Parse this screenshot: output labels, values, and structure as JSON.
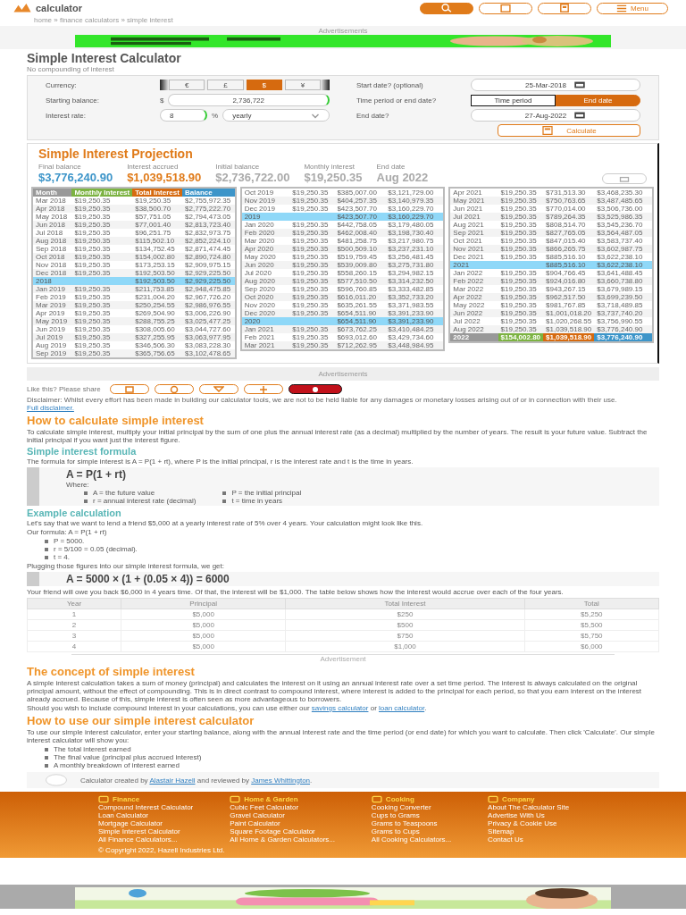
{
  "header": {
    "logo": "calculator",
    "breadcrumb": "home » finance calculators » simple interest",
    "menu_label": "Menu"
  },
  "top_ad": {
    "label": "Advertisements"
  },
  "title": "Simple Interest Calculator",
  "subtitle": "No compounding of interest",
  "form": {
    "currency": {
      "label": "Currency:",
      "options": [
        {
          "label": "€",
          "selected": false
        },
        {
          "label": "£",
          "selected": false
        },
        {
          "label": "$",
          "selected": true
        },
        {
          "label": "¥",
          "selected": false
        }
      ]
    },
    "starting_balance": {
      "label": "Starting balance:",
      "prefix": "$",
      "value": "2,736,722"
    },
    "interest_rate": {
      "label": "Interest rate:",
      "value": "8",
      "suffix": "%",
      "period": "yearly"
    },
    "start_date": {
      "label": "Start date? (optional)",
      "value": "25-Mar-2018"
    },
    "period_mode": {
      "label": "Time period or end date?",
      "options": [
        {
          "label": "Time period",
          "selected": false
        },
        {
          "label": "End date",
          "selected": true
        }
      ]
    },
    "end_date": {
      "label": "End date?",
      "value": "27-Aug-2022"
    },
    "calculate": "Calculate"
  },
  "projection": {
    "title": "Simple Interest Projection",
    "stats": [
      {
        "label": "Final balance",
        "value": "$3,776,240.90",
        "kind": "primary"
      },
      {
        "label": "Interest accrued",
        "value": "$1,039,518.90",
        "kind": "accent"
      },
      {
        "label": "Initial balance",
        "value": "$2,736,722.00",
        "kind": "muted"
      },
      {
        "label": "Monthly interest",
        "value": "$19,250.35",
        "kind": "muted"
      },
      {
        "label": "End date",
        "value": "Aug 2022",
        "kind": "muted"
      }
    ]
  },
  "table": {
    "columns": [
      "Month",
      "Monthly Interest",
      "Total Interest",
      "Balance"
    ],
    "parts": [
      {
        "rows": [
          {
            "kind": "month",
            "cells": [
              "Mar 2018",
              "$19,250.35",
              "$19,250.35",
              "$2,755,972.35"
            ]
          },
          {
            "kind": "month",
            "cells": [
              "Apr 2018",
              "$19,250.35",
              "$38,500.70",
              "$2,775,222.70"
            ]
          },
          {
            "kind": "month",
            "cells": [
              "May 2018",
              "$19,250.35",
              "$57,751.05",
              "$2,794,473.05"
            ]
          },
          {
            "kind": "month",
            "cells": [
              "Jun 2018",
              "$19,250.35",
              "$77,001.40",
              "$2,813,723.40"
            ]
          },
          {
            "kind": "month",
            "cells": [
              "Jul 2018",
              "$19,250.35",
              "$96,251.75",
              "$2,832,973.75"
            ]
          },
          {
            "kind": "month",
            "cells": [
              "Aug 2018",
              "$19,250.35",
              "$115,502.10",
              "$2,852,224.10"
            ]
          },
          {
            "kind": "month",
            "cells": [
              "Sep 2018",
              "$19,250.35",
              "$134,752.45",
              "$2,871,474.45"
            ]
          },
          {
            "kind": "month",
            "cells": [
              "Oct 2018",
              "$19,250.35",
              "$154,002.80",
              "$2,890,724.80"
            ]
          },
          {
            "kind": "month",
            "cells": [
              "Nov 2018",
              "$19,250.35",
              "$173,253.15",
              "$2,909,975.15"
            ]
          },
          {
            "kind": "month",
            "cells": [
              "Dec 2018",
              "$19,250.35",
              "$192,503.50",
              "$2,929,225.50"
            ]
          },
          {
            "kind": "year",
            "cells": [
              "2018",
              "",
              "$192,503.50",
              "$2,929,225.50"
            ]
          },
          {
            "kind": "month",
            "cells": [
              "Jan 2019",
              "$19,250.35",
              "$211,753.85",
              "$2,948,475.85"
            ]
          },
          {
            "kind": "month",
            "cells": [
              "Feb 2019",
              "$19,250.35",
              "$231,004.20",
              "$2,967,726.20"
            ]
          },
          {
            "kind": "month",
            "cells": [
              "Mar 2019",
              "$19,250.35",
              "$250,254.55",
              "$2,986,976.55"
            ]
          },
          {
            "kind": "month",
            "cells": [
              "Apr 2019",
              "$19,250.35",
              "$269,504.90",
              "$3,006,226.90"
            ]
          },
          {
            "kind": "month",
            "cells": [
              "May 2019",
              "$19,250.35",
              "$288,755.25",
              "$3,025,477.25"
            ]
          },
          {
            "kind": "month",
            "cells": [
              "Jun 2019",
              "$19,250.35",
              "$308,005.60",
              "$3,044,727.60"
            ]
          },
          {
            "kind": "month",
            "cells": [
              "Jul 2019",
              "$19,250.35",
              "$327,255.95",
              "$3,063,977.95"
            ]
          },
          {
            "kind": "month",
            "cells": [
              "Aug 2019",
              "$19,250.35",
              "$346,506.30",
              "$3,083,228.30"
            ]
          },
          {
            "kind": "month",
            "cells": [
              "Sep 2019",
              "$19,250.35",
              "$365,756.65",
              "$3,102,478.65"
            ]
          }
        ]
      },
      {
        "rows": [
          {
            "kind": "month",
            "cells": [
              "Oct 2019",
              "$19,250.35",
              "$385,007.00",
              "$3,121,729.00"
            ]
          },
          {
            "kind": "month",
            "cells": [
              "Nov 2019",
              "$19,250.35",
              "$404,257.35",
              "$3,140,979.35"
            ]
          },
          {
            "kind": "month",
            "cells": [
              "Dec 2019",
              "$19,250.35",
              "$423,507.70",
              "$3,160,229.70"
            ]
          },
          {
            "kind": "year",
            "cells": [
              "2019",
              "",
              "$423,507.70",
              "$3,160,229.70"
            ]
          },
          {
            "kind": "month",
            "cells": [
              "Jan 2020",
              "$19,250.35",
              "$442,758.05",
              "$3,179,480.05"
            ]
          },
          {
            "kind": "month",
            "cells": [
              "Feb 2020",
              "$19,250.35",
              "$462,008.40",
              "$3,198,730.40"
            ]
          },
          {
            "kind": "month",
            "cells": [
              "Mar 2020",
              "$19,250.35",
              "$481,258.75",
              "$3,217,980.75"
            ]
          },
          {
            "kind": "month",
            "cells": [
              "Apr 2020",
              "$19,250.35",
              "$500,509.10",
              "$3,237,231.10"
            ]
          },
          {
            "kind": "month",
            "cells": [
              "May 2020",
              "$19,250.35",
              "$519,759.45",
              "$3,256,481.45"
            ]
          },
          {
            "kind": "month",
            "cells": [
              "Jun 2020",
              "$19,250.35",
              "$539,009.80",
              "$3,275,731.80"
            ]
          },
          {
            "kind": "month",
            "cells": [
              "Jul 2020",
              "$19,250.35",
              "$558,260.15",
              "$3,294,982.15"
            ]
          },
          {
            "kind": "month",
            "cells": [
              "Aug 2020",
              "$19,250.35",
              "$577,510.50",
              "$3,314,232.50"
            ]
          },
          {
            "kind": "month",
            "cells": [
              "Sep 2020",
              "$19,250.35",
              "$596,760.85",
              "$3,333,482.85"
            ]
          },
          {
            "kind": "month",
            "cells": [
              "Oct 2020",
              "$19,250.35",
              "$616,011.20",
              "$3,352,733.20"
            ]
          },
          {
            "kind": "month",
            "cells": [
              "Nov 2020",
              "$19,250.35",
              "$635,261.55",
              "$3,371,983.55"
            ]
          },
          {
            "kind": "month",
            "cells": [
              "Dec 2020",
              "$19,250.35",
              "$654,511.90",
              "$3,391,233.90"
            ]
          },
          {
            "kind": "year",
            "cells": [
              "2020",
              "",
              "$654,511.90",
              "$3,391,233.90"
            ]
          },
          {
            "kind": "month",
            "cells": [
              "Jan 2021",
              "$19,250.35",
              "$673,762.25",
              "$3,410,484.25"
            ]
          },
          {
            "kind": "month",
            "cells": [
              "Feb 2021",
              "$19,250.35",
              "$693,012.60",
              "$3,429,734.60"
            ]
          },
          {
            "kind": "month",
            "cells": [
              "Mar 2021",
              "$19,250.35",
              "$712,262.95",
              "$3,448,984.95"
            ]
          }
        ]
      },
      {
        "rows": [
          {
            "kind": "month",
            "cells": [
              "Apr 2021",
              "$19,250.35",
              "$731,513.30",
              "$3,468,235.30"
            ]
          },
          {
            "kind": "month",
            "cells": [
              "May 2021",
              "$19,250.35",
              "$750,763.65",
              "$3,487,485.65"
            ]
          },
          {
            "kind": "month",
            "cells": [
              "Jun 2021",
              "$19,250.35",
              "$770,014.00",
              "$3,506,736.00"
            ]
          },
          {
            "kind": "month",
            "cells": [
              "Jul 2021",
              "$19,250.35",
              "$789,264.35",
              "$3,525,986.35"
            ]
          },
          {
            "kind": "month",
            "cells": [
              "Aug 2021",
              "$19,250.35",
              "$808,514.70",
              "$3,545,236.70"
            ]
          },
          {
            "kind": "month",
            "cells": [
              "Sep 2021",
              "$19,250.35",
              "$827,765.05",
              "$3,564,487.05"
            ]
          },
          {
            "kind": "month",
            "cells": [
              "Oct 2021",
              "$19,250.35",
              "$847,015.40",
              "$3,583,737.40"
            ]
          },
          {
            "kind": "month",
            "cells": [
              "Nov 2021",
              "$19,250.35",
              "$866,265.75",
              "$3,602,987.75"
            ]
          },
          {
            "kind": "month",
            "cells": [
              "Dec 2021",
              "$19,250.35",
              "$885,516.10",
              "$3,622,238.10"
            ]
          },
          {
            "kind": "year",
            "cells": [
              "2021",
              "",
              "$885,516.10",
              "$3,622,238.10"
            ]
          },
          {
            "kind": "month",
            "cells": [
              "Jan 2022",
              "$19,250.35",
              "$904,766.45",
              "$3,641,488.45"
            ]
          },
          {
            "kind": "month",
            "cells": [
              "Feb 2022",
              "$19,250.35",
              "$924,016.80",
              "$3,660,738.80"
            ]
          },
          {
            "kind": "month",
            "cells": [
              "Mar 2022",
              "$19,250.35",
              "$943,267.15",
              "$3,679,989.15"
            ]
          },
          {
            "kind": "month",
            "cells": [
              "Apr 2022",
              "$19,250.35",
              "$962,517.50",
              "$3,699,239.50"
            ]
          },
          {
            "kind": "month",
            "cells": [
              "May 2022",
              "$19,250.35",
              "$981,767.85",
              "$3,718,489.85"
            ]
          },
          {
            "kind": "month",
            "cells": [
              "Jun 2022",
              "$19,250.35",
              "$1,001,018.20",
              "$3,737,740.20"
            ]
          },
          {
            "kind": "month",
            "cells": [
              "Jul 2022",
              "$19,250.35",
              "$1,020,268.55",
              "$3,756,990.55"
            ]
          },
          {
            "kind": "month",
            "cells": [
              "Aug 2022",
              "$19,250.35",
              "$1,039,518.90",
              "$3,776,240.90"
            ]
          }
        ]
      }
    ],
    "footer": [
      "2022",
      "$154,002.80",
      "$1,039,518.90",
      "$3,776,240.90"
    ]
  },
  "mid_ad": {
    "label": "Advertisements"
  },
  "share": {
    "label": "Like this? Please share"
  },
  "disclaimer": {
    "text": "Disclaimer: Whilst every effort has been made in building our calculator tools, we are not to be held liable for any damages or monetary losses arising out of or in connection with their use.",
    "link": "Full disclaimer."
  },
  "article": [
    {
      "kind": "h2",
      "text": "How to calculate simple interest"
    },
    {
      "kind": "p",
      "parts": [
        {
          "text": "To calculate simple interest, multiply your initial principal by the sum of one plus the annual interest rate (as a decimal) multiplied by the number of years. The result is your future value. Subtract the initial principal if you want just the interest figure."
        }
      ]
    },
    {
      "kind": "h3",
      "text": "Simple interest formula"
    },
    {
      "kind": "p",
      "parts": [
        {
          "text": "The formula for simple interest is A = P(1 + rt), where P is the initial principal, r is the interest rate and t is the time in years."
        }
      ]
    },
    {
      "kind": "formula",
      "equation": "A = P(1 + rt)",
      "where": "Where:",
      "items": [
        "A = the future value",
        "P = the initial principal",
        "r = annual interest rate (decimal)",
        "t = time in years"
      ]
    },
    {
      "kind": "h3",
      "text": "Example calculation"
    },
    {
      "kind": "p",
      "parts": [
        {
          "text": "Let's say that we want to lend a friend $5,000 at a yearly interest rate of 5% over 4 years. Your calculation might look like this."
        }
      ]
    },
    {
      "kind": "p",
      "parts": [
        {
          "text": "Our formula: A = P(1 + rt)"
        }
      ]
    },
    {
      "kind": "list",
      "items": [
        "P = 5000.",
        "r = 5/100 = 0.05 (decimal).",
        "t = 4."
      ]
    },
    {
      "kind": "p",
      "parts": [
        {
          "text": "Plugging those figures into our simple interest formula, we get:"
        }
      ]
    },
    {
      "kind": "formula",
      "equation": "A = 5000 × (1 + (0.05 × 4)) = 6000"
    },
    {
      "kind": "p",
      "parts": [
        {
          "text": "Your friend will owe you back $6,000 in 4 years time. Of that, the interest will be $1,000. The table below shows how the interest would accrue over each of the four years."
        }
      ]
    },
    {
      "kind": "table",
      "columns": [
        "Year",
        "Principal",
        "Total Interest",
        "Total"
      ],
      "rows": [
        [
          "1",
          "$5,000",
          "$250",
          "$5,250"
        ],
        [
          "2",
          "$5,000",
          "$500",
          "$5,500"
        ],
        [
          "3",
          "$5,000",
          "$750",
          "$5,750"
        ],
        [
          "4",
          "$5,000",
          "$1,000",
          "$6,000"
        ]
      ]
    },
    {
      "kind": "ad",
      "label": "Advertisement"
    },
    {
      "kind": "h2",
      "text": "The concept of simple interest"
    },
    {
      "kind": "p",
      "parts": [
        {
          "text": "A simple interest calculation takes a sum of money (principal) and calculates the interest on it using an annual interest rate over a set time period. The interest is always calculated on the original principal amount, without the effect of compounding. This is in direct contrast to compound interest, where interest is added to the principal for each period, so that you earn interest on the interest already accrued. Because of this, simple interest is often seen as more advantageous to borrowers."
        }
      ]
    },
    {
      "kind": "p",
      "parts": [
        {
          "text": "Should you wish to include compound interest in your calculations, you can use either our "
        },
        {
          "text": "savings calculator",
          "link": true
        },
        {
          "text": " or "
        },
        {
          "text": "loan calculator",
          "link": true
        },
        {
          "text": "."
        }
      ]
    },
    {
      "kind": "h2",
      "text": "How to use our simple interest calculator"
    },
    {
      "kind": "p",
      "parts": [
        {
          "text": "To use our simple interest calculator, enter your starting balance, along with the annual interest rate and the time period (or end date) for which you want to calculate. Then click 'Calculate'. Our simple interest calculator will show you:"
        }
      ]
    },
    {
      "kind": "list",
      "items": [
        "The total interest earned",
        "The final value (principal plus accrued interest)",
        "A monthly breakdown of interest earned"
      ]
    },
    {
      "kind": "author",
      "parts": [
        {
          "text": "Calculator created by "
        },
        {
          "text": "Alastair Hazell",
          "link": true
        },
        {
          "text": " and reviewed by "
        },
        {
          "text": "James Whittington",
          "link": true
        },
        {
          "text": "."
        }
      ]
    }
  ],
  "footer": {
    "sections": [
      {
        "title": "Finance",
        "links": [
          "Compound Interest Calculator",
          "Loan Calculator",
          "Mortgage Calculator",
          "Simple Interest Calculator",
          "All Finance Calculators..."
        ]
      },
      {
        "title": "Home & Garden",
        "links": [
          "Cubic Feet Calculator",
          "Gravel Calculator",
          "Paint Calculator",
          "Square Footage Calculator",
          "All Home & Garden Calculators..."
        ]
      },
      {
        "title": "Cooking",
        "links": [
          "Cooking Converter",
          "Cups to Grams",
          "Grams to Teaspoons",
          "Grams to Cups",
          "All Cooking Calculators..."
        ]
      },
      {
        "title": "Company",
        "links": [
          "About The Calculator Site",
          "Advertise With Us",
          "Privacy & Cookie Use",
          "Sitemap",
          "Contact Us"
        ]
      }
    ],
    "copyright": "© Copyright 2022, Hazell Industries Ltd."
  }
}
